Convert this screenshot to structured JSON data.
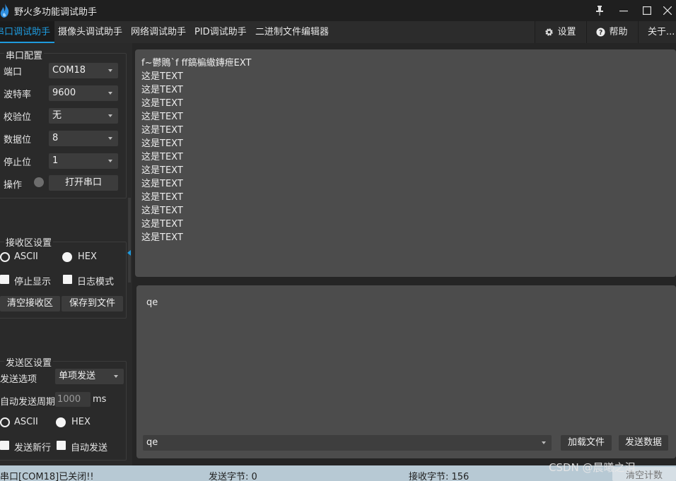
{
  "window": {
    "title": "野火多功能调试助手"
  },
  "tabs": [
    {
      "label": "串口调试助手",
      "active": true
    },
    {
      "label": "摄像头调试助手"
    },
    {
      "label": "网络调试助手"
    },
    {
      "label": "PID调试助手"
    },
    {
      "label": "二进制文件编辑器"
    }
  ],
  "toolbar": {
    "settings": "设置",
    "help": "帮助",
    "about": "关于..."
  },
  "serial_config": {
    "title": "串口配置",
    "port": {
      "label": "端口",
      "value": "COM18"
    },
    "baud": {
      "label": "波特率",
      "value": "9600"
    },
    "parity": {
      "label": "校验位",
      "value": "无"
    },
    "databits": {
      "label": "数据位",
      "value": "8"
    },
    "stopbits": {
      "label": "停止位",
      "value": "1"
    },
    "operation": {
      "label": "操作",
      "button": "打开串口"
    }
  },
  "receive_settings": {
    "title": "接收区设置",
    "ascii": "ASCII",
    "hex": "HEX",
    "stop_display": "停止显示",
    "log_mode": "日志模式",
    "clear": "清空接收区",
    "save": "保存到文件"
  },
  "send_settings": {
    "title": "发送区设置",
    "option_label": "发送选项",
    "option_value": "单项发送",
    "period_label": "自动发送周期",
    "period_value": "1000",
    "period_unit": "ms",
    "ascii": "ASCII",
    "hex": "HEX",
    "newline": "发送新行",
    "auto_send": "自动发送"
  },
  "receive_area": {
    "lines": [
      "f~鬱鵙`f ff鎬楄繖鏄疶EXT",
      "这是TEXT",
      "这是TEXT",
      "这是TEXT",
      "这是TEXT",
      "这是TEXT",
      "这是TEXT",
      "这是TEXT",
      "这是TEXT",
      "这是TEXT",
      "这是TEXT",
      "这是TEXT",
      "这是TEXT",
      "这是TEXT"
    ]
  },
  "send_area": {
    "text": "qe",
    "history_value": "qe",
    "load_file": "加载文件",
    "send_data": "发送数据"
  },
  "statusbar": {
    "port_status": "串口[COM18]已关闭!!",
    "sent_bytes": "发送字节: 0",
    "recv_bytes": "接收字节: 156",
    "clear_count": "清空计数"
  },
  "watermark": "CSDN @晨曦之泪"
}
